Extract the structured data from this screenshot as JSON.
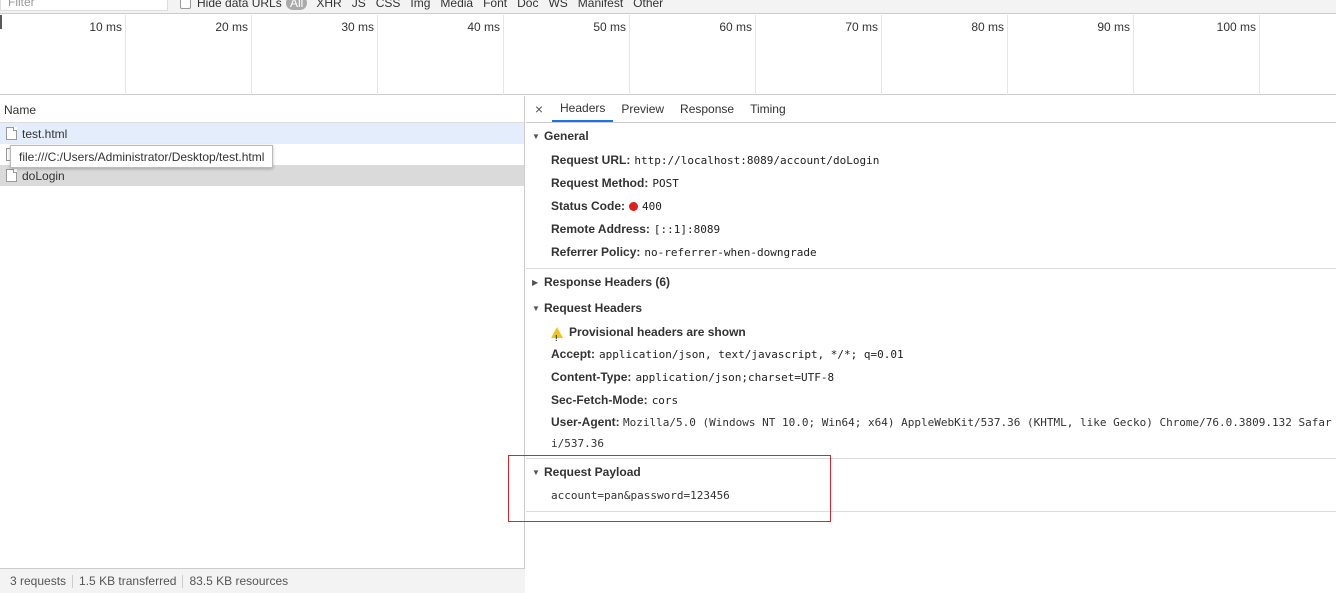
{
  "filterbar": {
    "filter_placeholder": "Filter",
    "hide_data_urls": "Hide data URLs",
    "types": [
      "All",
      "XHR",
      "JS",
      "CSS",
      "Img",
      "Media",
      "Font",
      "Doc",
      "WS",
      "Manifest",
      "Other"
    ]
  },
  "timeline": {
    "ticks": [
      "10 ms",
      "20 ms",
      "30 ms",
      "40 ms",
      "50 ms",
      "60 ms",
      "70 ms",
      "80 ms",
      "90 ms",
      "100 ms"
    ]
  },
  "requests": {
    "header": "Name",
    "items": [
      "test.html",
      "",
      "doLogin"
    ],
    "tooltip": "file:///C:/Users/Administrator/Desktop/test.html"
  },
  "status": {
    "requests": "3 requests",
    "transferred": "1.5 KB transferred",
    "resources": "83.5 KB resources"
  },
  "detail": {
    "close": "×",
    "tabs": [
      "Headers",
      "Preview",
      "Response",
      "Timing"
    ],
    "general": {
      "title": "General",
      "request_url_k": "Request URL:",
      "request_url_v": "http://localhost:8089/account/doLogin",
      "method_k": "Request Method:",
      "method_v": "POST",
      "status_k": "Status Code:",
      "status_v": "400",
      "remote_k": "Remote Address:",
      "remote_v": "[::1]:8089",
      "referrer_k": "Referrer Policy:",
      "referrer_v": "no-referrer-when-downgrade"
    },
    "response_headers": {
      "title": "Response Headers (6)"
    },
    "request_headers": {
      "title": "Request Headers",
      "warning": "Provisional headers are shown",
      "accept_k": "Accept:",
      "accept_v": "application/json, text/javascript, */*; q=0.01",
      "ctype_k": "Content-Type:",
      "ctype_v": "application/json;charset=UTF-8",
      "fetch_k": "Sec-Fetch-Mode:",
      "fetch_v": "cors",
      "ua_k": "User-Agent:",
      "ua_v": "Mozilla/5.0 (Windows NT 10.0; Win64; x64) AppleWebKit/537.36 (KHTML, like Gecko) Chrome/76.0.3809.132 Safari/537.36"
    },
    "payload": {
      "title": "Request Payload",
      "value": "account=pan&password=123456"
    }
  },
  "colors": {
    "accent": "#1a73e8",
    "status_error": "#e0201b",
    "highlight_box": "#d8262c",
    "selected_row": "#e3edfb"
  }
}
